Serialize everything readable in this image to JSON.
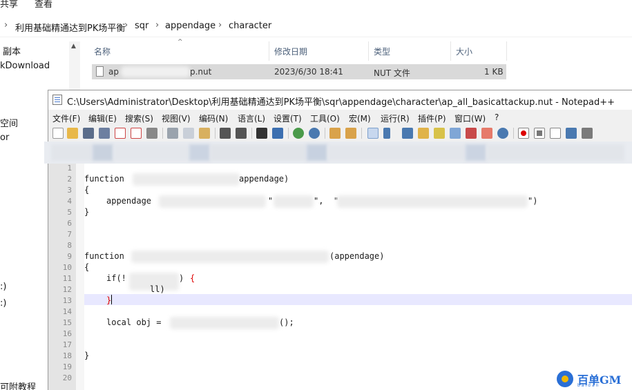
{
  "explorer": {
    "top_menu": [
      "共享",
      "查看"
    ],
    "breadcrumb": [
      "利用基础精通达到PK场平衡",
      "sqr",
      "appendage",
      "character"
    ],
    "nav_items": [
      "副本",
      "kDownload",
      "空间",
      "or",
      ":)",
      ":)",
      "可附教程"
    ],
    "columns": {
      "name": "名称",
      "modified": "修改日期",
      "type": "类型",
      "size": "大小"
    },
    "file": {
      "name_prefix": "ap",
      "name_suffix": "p.nut",
      "modified": "2023/6/30 18:41",
      "type": "NUT 文件",
      "size": "1 KB"
    }
  },
  "notepad": {
    "title": "C:\\Users\\Administrator\\Desktop\\利用基础精通达到PK场平衡\\sqr\\appendage\\character\\ap_all_basicattackup.nut - Notepad++",
    "menu": [
      "文件(F)",
      "编辑(E)",
      "搜索(S)",
      "视图(V)",
      "编码(N)",
      "语言(L)",
      "设置(T)",
      "工具(O)",
      "宏(M)",
      "运行(R)",
      "插件(P)",
      "窗口(W)",
      "?"
    ],
    "line_numbers": [
      "1",
      "2",
      "3",
      "4",
      "5",
      "6",
      "7",
      "8",
      "9",
      "10",
      "11",
      "12",
      "13",
      "14",
      "15",
      "16",
      "17",
      "18",
      "19",
      "20"
    ],
    "code": {
      "l2a": "function",
      "l2b": "appendage)",
      "l3": "{",
      "l4a": "appendage",
      "l4b": "\"",
      "l4c": "\",  \"",
      "l4d": "\")",
      "l5": "}",
      "l9a": "function",
      "l9b": "(appendage)",
      "l10": "{",
      "l11a": "if(!",
      "l11b": ") ",
      "l11c": "{",
      "l12": "ll)",
      "l13": "}",
      "l15a": "local obj =",
      "l15b": "();",
      "l18": "}"
    },
    "toolbar_icons": [
      "new-file-icon",
      "open-file-icon",
      "save-icon",
      "save-all-icon",
      "close-icon",
      "close-all-icon",
      "print-icon",
      "cut-icon",
      "copy-icon",
      "paste-icon",
      "undo-icon",
      "redo-icon",
      "find-icon",
      "replace-icon",
      "zoom-in-icon",
      "zoom-out-icon",
      "sync-v-icon",
      "sync-h-icon",
      "word-wrap-icon",
      "show-all-chars-icon",
      "indent-guide-icon",
      "doc-map-icon",
      "function-list-icon",
      "folder-workspace-icon",
      "monitor-icon",
      "record-macro-icon",
      "stop-record-icon",
      "play-macro-icon",
      "run-macro-multiple-icon",
      "save-macro-icon"
    ]
  },
  "watermark": {
    "text": "百单GM",
    "sub": "baidan"
  }
}
